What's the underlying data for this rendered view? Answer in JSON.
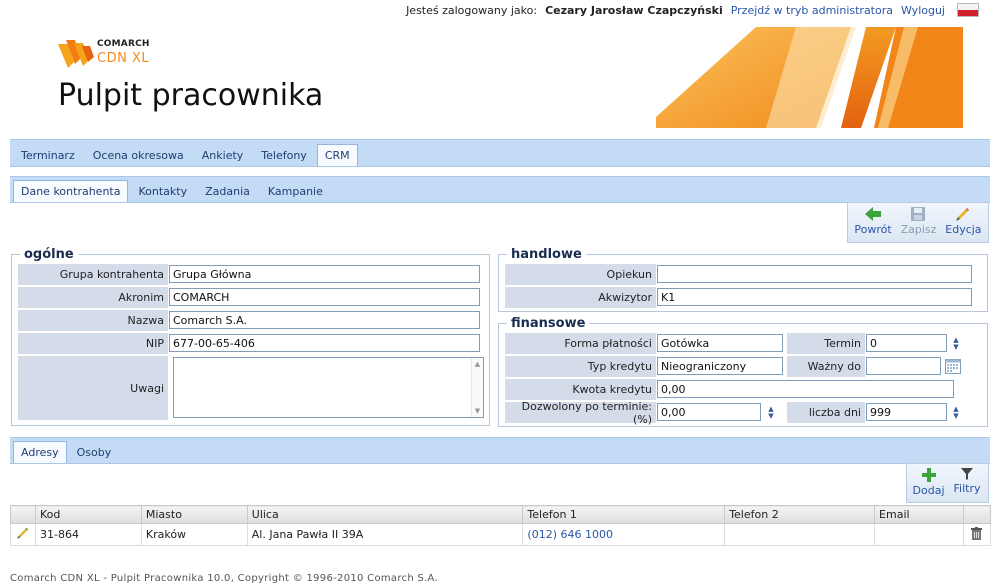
{
  "topbar": {
    "logged_in_label": "Jesteś zalogowany jako:",
    "user_name": "Cezary Jarosław Czapczyński",
    "admin_link": "Przejdź w tryb administratora",
    "logout_link": "Wyloguj"
  },
  "header": {
    "logo_line1": "COMARCH",
    "logo_line2": "CDN XL",
    "title": "Pulpit pracownika"
  },
  "main_tabs": [
    "Terminarz",
    "Ocena okresowa",
    "Ankiety",
    "Telefony",
    "CRM"
  ],
  "main_tab_active": "CRM",
  "sub_tabs": [
    "Dane kontrahenta",
    "Kontakty",
    "Zadania",
    "Kampanie"
  ],
  "sub_tab_active": "Dane kontrahenta",
  "toolbar": {
    "back": "Powrót",
    "save": "Zapisz",
    "edit": "Edycja"
  },
  "ogolne": {
    "legend": "ogólne",
    "fields": [
      {
        "label": "Grupa kontrahenta",
        "value": "Grupa Główna"
      },
      {
        "label": "Akronim",
        "value": "COMARCH"
      },
      {
        "label": "Nazwa",
        "value": "Comarch S.A."
      },
      {
        "label": "NIP",
        "value": "677-00-65-406"
      }
    ],
    "uwagi_label": "Uwagi",
    "uwagi_value": ""
  },
  "handlowe": {
    "legend": "handlowe",
    "opiekun_label": "Opiekun",
    "opiekun_value": "",
    "akwizytor_label": "Akwizytor",
    "akwizytor_value": "K1"
  },
  "finansowe": {
    "legend": "finansowe",
    "forma_platnosci_label": "Forma płatności",
    "forma_platnosci_value": "Gotówka",
    "termin_label": "Termin",
    "termin_value": "0",
    "typ_kredytu_label": "Typ kredytu",
    "typ_kredytu_value": "Nieograniczony",
    "wazny_do_label": "Ważny do",
    "wazny_do_value": "",
    "kwota_kredytu_label": "Kwota kredytu",
    "kwota_kredytu_value": "0,00",
    "dozwolony_label": "Dozwolony po terminie: (%)",
    "dozwolony_value": "0,00",
    "liczba_dni_label": "liczba dni",
    "liczba_dni_value": "999"
  },
  "bottom_tabs": [
    "Adresy",
    "Osoby"
  ],
  "bottom_tab_active": "Adresy",
  "grid_toolbar": {
    "add": "Dodaj",
    "filters": "Filtry"
  },
  "grid": {
    "columns": [
      "Kod",
      "Miasto",
      "Ulica",
      "Telefon 1",
      "Telefon 2",
      "Email"
    ],
    "rows": [
      {
        "kod": "31-864",
        "miasto": "Kraków",
        "ulica": "Al. Jana Pawła II 39A",
        "telefon1": "(012) 646 1000",
        "telefon2": "",
        "email": ""
      }
    ]
  },
  "footer": "Comarch CDN XL - Pulpit Pracownika 10.0, Copyright © 1996-2010 Comarch S.A.",
  "colors": {
    "tabbar_bg": "#c4dbf6",
    "label_bg": "#d4dcea",
    "link": "#2a56a8",
    "brand_orange": "#f28a1a"
  }
}
